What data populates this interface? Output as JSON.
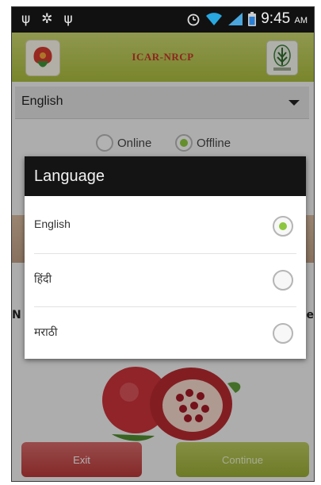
{
  "status_bar": {
    "time": "9:45",
    "ampm": "AM"
  },
  "app_bar": {
    "title": "ICAR-NRCP"
  },
  "spinner": {
    "value": "English"
  },
  "mode": {
    "online_label": "Online",
    "offline_label": "Offline",
    "selected": "Offline"
  },
  "background": {
    "left_edge_char": "N",
    "right_edge_char": "e"
  },
  "dialog": {
    "title": "Language",
    "options": [
      {
        "label": "English",
        "selected": true
      },
      {
        "label": "हिंदी",
        "selected": false
      },
      {
        "label": "मराठी",
        "selected": false
      }
    ]
  },
  "buttons": {
    "exit_label": "Exit",
    "continue_label": "Continue"
  },
  "colors": {
    "app_bar": "#b4c44c",
    "radio_selected": "#8cc63e",
    "exit_button": "#c24848",
    "continue_button": "#a8b93c"
  }
}
